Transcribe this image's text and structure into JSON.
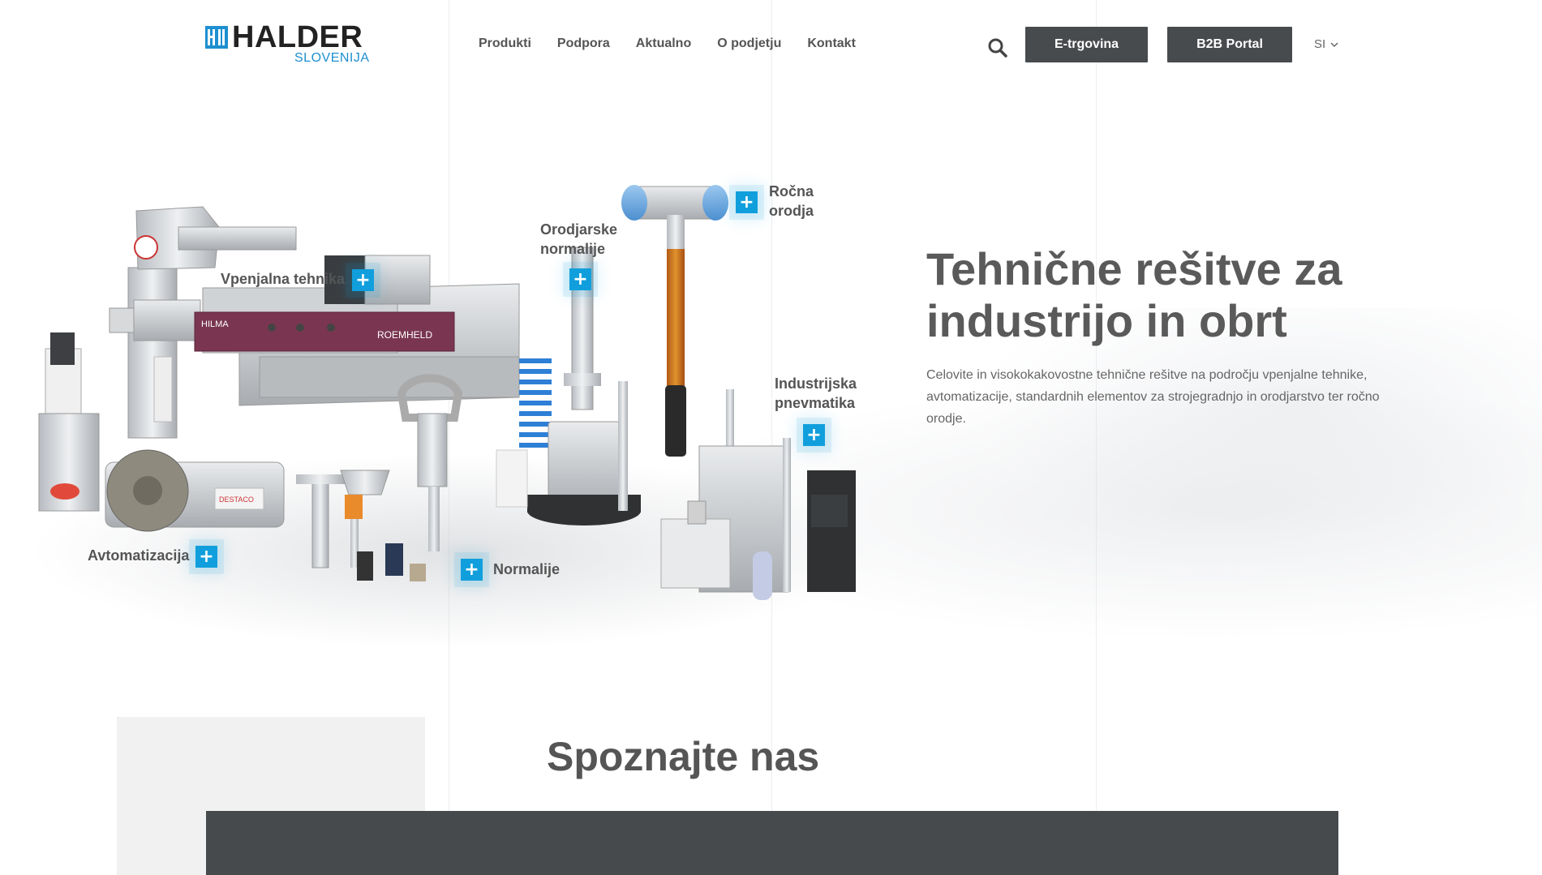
{
  "brand": {
    "name": "HALDER",
    "subtitle": "SLOVENIJA",
    "colors": {
      "accent": "#109fdc",
      "dark_button": "#484b4e",
      "text": "#555555"
    }
  },
  "nav": {
    "items": [
      "Produkti",
      "Podpora",
      "Aktualno",
      "O podjetju",
      "Kontakt"
    ]
  },
  "header": {
    "search_icon": "search-icon",
    "eshop_label": "E-trgovina",
    "b2b_label": "B2B Portal",
    "language": "SI"
  },
  "hero": {
    "title": "Tehnične rešitve za industrijo in obrt",
    "description": "Celovite in visokokakovostne tehnične rešitve na področju vpenjalne tehnike, avtomatizacije, standardnih elementov za strojegradnjo in orodjarstvo ter ročno orodje.",
    "categories": [
      {
        "label": "Vpenjalna tehnika",
        "icon": "plus-icon"
      },
      {
        "label": "Orodjarske normalije",
        "icon": "plus-icon"
      },
      {
        "label": "Ročna orodja",
        "icon": "plus-icon"
      },
      {
        "label": "Industrijska pnevmatika",
        "icon": "plus-icon"
      },
      {
        "label": "Avtomatizacija",
        "icon": "plus-icon"
      },
      {
        "label": "Normalije",
        "icon": "plus-icon"
      }
    ],
    "product_labels": {
      "hilma": "HILMA",
      "roemheld": "ROEMHELD",
      "destaco": "DESTACO"
    }
  },
  "section": {
    "title": "Spoznajte nas"
  }
}
